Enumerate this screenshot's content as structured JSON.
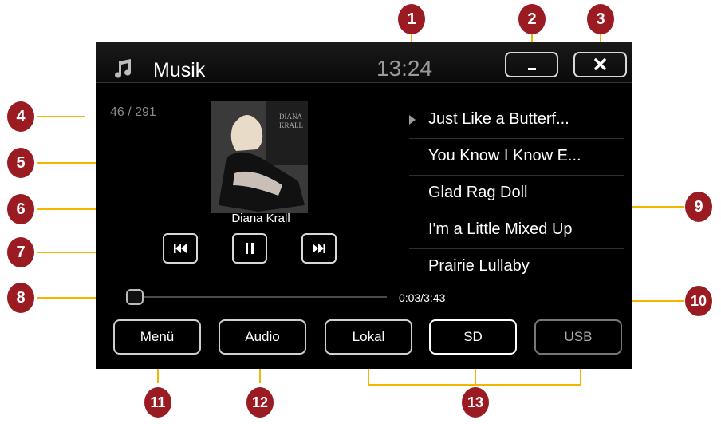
{
  "header": {
    "title": "Musik",
    "clock": "13:24",
    "minimize_label": "",
    "close_label": ""
  },
  "track": {
    "counter": "46 / 291",
    "artist": "Diana Krall",
    "elapsed_total": "0:03/3:43",
    "progress_fraction": 0.01
  },
  "playlist": [
    {
      "title": "Just Like a Butterf...",
      "playing": true
    },
    {
      "title": "You Know I Know E...",
      "playing": false
    },
    {
      "title": "Glad Rag Doll",
      "playing": false
    },
    {
      "title": "I'm a Little Mixed Up",
      "playing": false
    },
    {
      "title": "Prairie Lullaby",
      "playing": false
    }
  ],
  "bottom_buttons": {
    "menu": "Menü",
    "audio": "Audio",
    "lokal": "Lokal",
    "sd": "SD",
    "usb": "USB"
  },
  "callouts": [
    "1",
    "2",
    "3",
    "4",
    "5",
    "6",
    "7",
    "8",
    "9",
    "10",
    "11",
    "12",
    "13"
  ],
  "colors": {
    "callout_fill": "#9b1b22",
    "leader_line": "#f2b600",
    "screen_bg": "#000000"
  },
  "icons": {
    "music": "music-note-icon",
    "minimize": "minimize-icon",
    "close": "close-icon",
    "prev": "skip-back-icon",
    "pause": "pause-icon",
    "next": "skip-forward-icon",
    "playing": "play-indicator-icon"
  }
}
